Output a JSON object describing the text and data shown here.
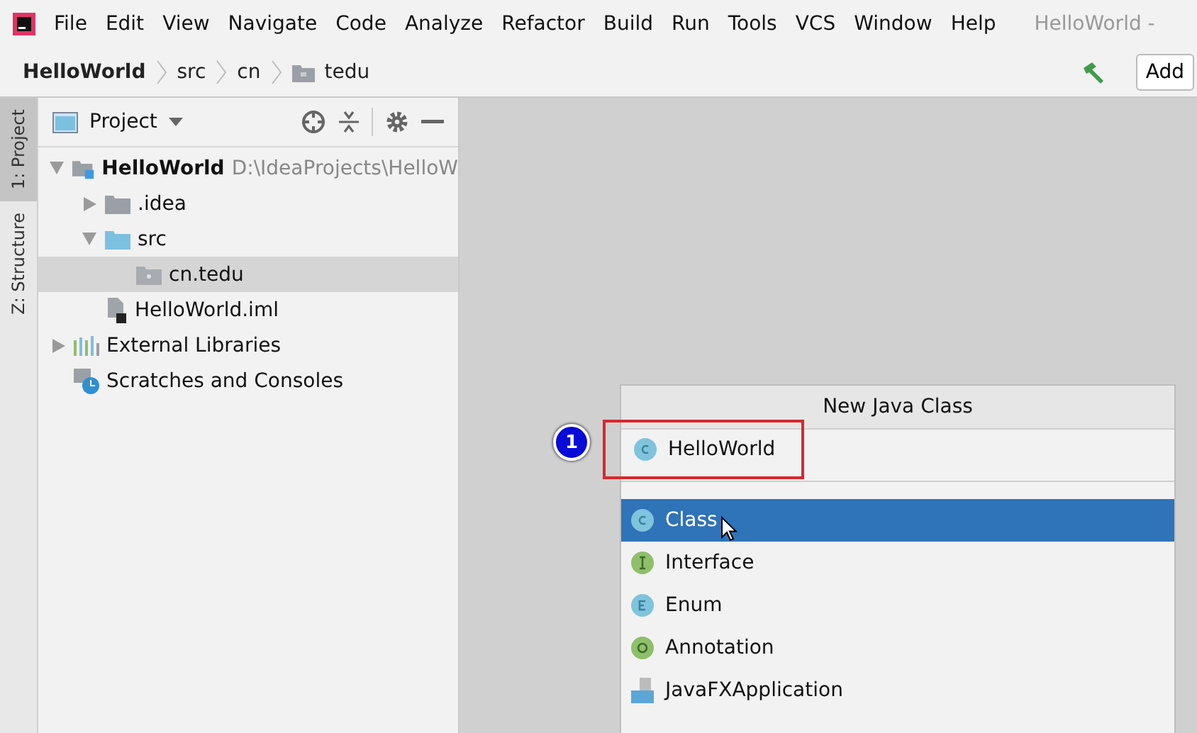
{
  "menu_bar": {
    "items": [
      "File",
      "Edit",
      "View",
      "Navigate",
      "Code",
      "Analyze",
      "Refactor",
      "Build",
      "Run",
      "Tools",
      "VCS",
      "Window",
      "Help"
    ],
    "title": "HelloWorld -"
  },
  "breadcrumbs": [
    "HelloWorld",
    "src",
    "cn",
    "tedu"
  ],
  "toolbar": {
    "button": "Add"
  },
  "side_tabs": [
    {
      "label": "1: Project",
      "selected": true
    },
    {
      "label": "Z: Structure",
      "selected": false
    }
  ],
  "project_panel": {
    "title": "Project",
    "tree": [
      {
        "kind": "module",
        "label": "HelloWorld",
        "path": "D:\\IdeaProjects\\HelloW",
        "expanded": true,
        "selected": false,
        "children": [
          {
            "kind": "folder",
            "label": ".idea",
            "expanded": false,
            "selected": false
          },
          {
            "kind": "source",
            "label": "src",
            "expanded": true,
            "selected": false,
            "children": [
              {
                "kind": "package",
                "label": "cn.tedu",
                "selected": true
              }
            ]
          },
          {
            "kind": "file",
            "label": "HelloWorld.iml",
            "selected": false
          }
        ]
      },
      {
        "kind": "libraries",
        "label": "External Libraries",
        "expanded": false,
        "selected": false
      },
      {
        "kind": "scratches",
        "label": "Scratches and Consoles",
        "selected": false
      }
    ]
  },
  "dialog": {
    "title": "New Java Class",
    "name_value": "HelloWorld",
    "callout": "1",
    "options": [
      {
        "kind": "class",
        "label": "Class",
        "selected": true
      },
      {
        "kind": "interface",
        "label": "Interface",
        "selected": false
      },
      {
        "kind": "enum",
        "label": "Enum",
        "selected": false
      },
      {
        "kind": "annotation",
        "label": "Annotation",
        "selected": false
      },
      {
        "kind": "javafx",
        "label": "JavaFXApplication",
        "selected": false
      }
    ]
  }
}
